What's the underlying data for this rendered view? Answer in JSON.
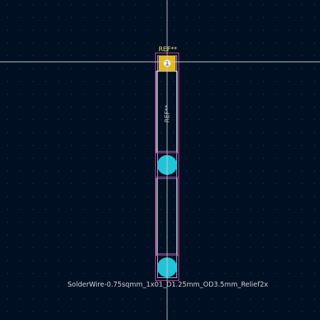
{
  "footprint": {
    "reference_label": "REF**",
    "fab_reference_label": "REF**",
    "value_label": "SolderWire-0.75sqmm_1x01_D1.25mm_OD3.5mm_Relief2x",
    "pads": [
      {
        "number": "1",
        "shape": "square",
        "role": "square-pad"
      },
      {
        "number": "",
        "shape": "circle",
        "role": "relief-hole-upper"
      },
      {
        "number": "",
        "shape": "circle",
        "role": "relief-hole-lower"
      }
    ]
  },
  "colors": {
    "background": "#001023",
    "grid_dot": "#3a4658",
    "crosshair": "#d0d0d0",
    "silkscreen": "#f2f2f2",
    "courtyard": "#c83ca0",
    "fab": "#aeb0cc",
    "square_pad": "#e3b623",
    "relief_hole": "#22c4d8",
    "reference_text": "#e8e25a"
  }
}
